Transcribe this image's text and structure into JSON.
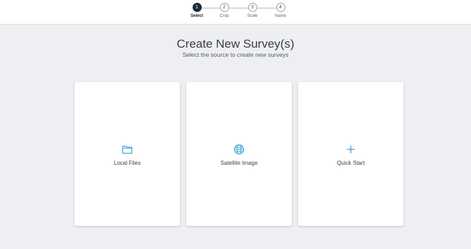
{
  "stepper": {
    "steps": [
      {
        "number": "1",
        "label": "Select",
        "active": true
      },
      {
        "number": "2",
        "label": "Crop",
        "active": false
      },
      {
        "number": "3",
        "label": "Scale",
        "active": false
      },
      {
        "number": "4",
        "label": "Name",
        "active": false
      }
    ]
  },
  "header": {
    "title": "Create New Survey(s)",
    "subtitle": "Select the source to create new surveys"
  },
  "sources": [
    {
      "label": "Local Files",
      "icon": "folder-icon"
    },
    {
      "label": "Satellite Image",
      "icon": "globe-icon"
    },
    {
      "label": "Quick Start",
      "icon": "plus-icon"
    }
  ],
  "colors": {
    "accent": "#4aa8d8",
    "active_step": "#1e2b3c",
    "background": "#eeeff2"
  }
}
